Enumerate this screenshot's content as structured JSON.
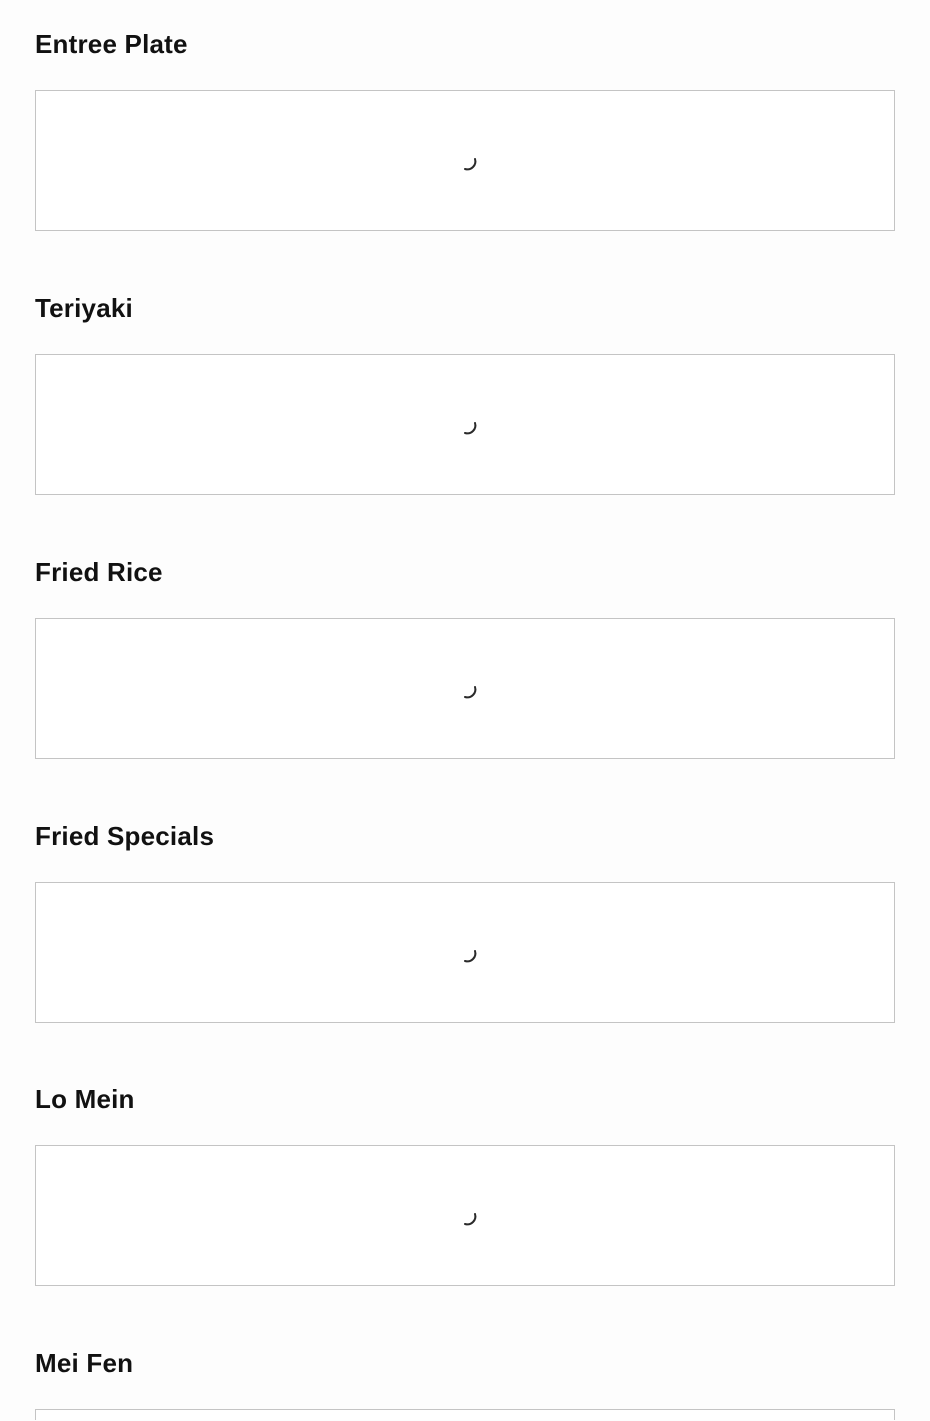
{
  "sections": [
    {
      "title": "Entree Plate",
      "state": "loading"
    },
    {
      "title": "Teriyaki",
      "state": "loading"
    },
    {
      "title": "Fried Rice",
      "state": "loading"
    },
    {
      "title": "Fried Specials",
      "state": "loading"
    },
    {
      "title": "Lo Mein",
      "state": "loading"
    },
    {
      "title": "Mei Fen",
      "state": "loading"
    }
  ],
  "icons": {
    "loading": "loading-spinner-icon"
  },
  "colors": {
    "background": "#fdfdfd",
    "panel_border": "#c4c4c4",
    "spinner": "#2a2a2a",
    "title": "#111111"
  }
}
